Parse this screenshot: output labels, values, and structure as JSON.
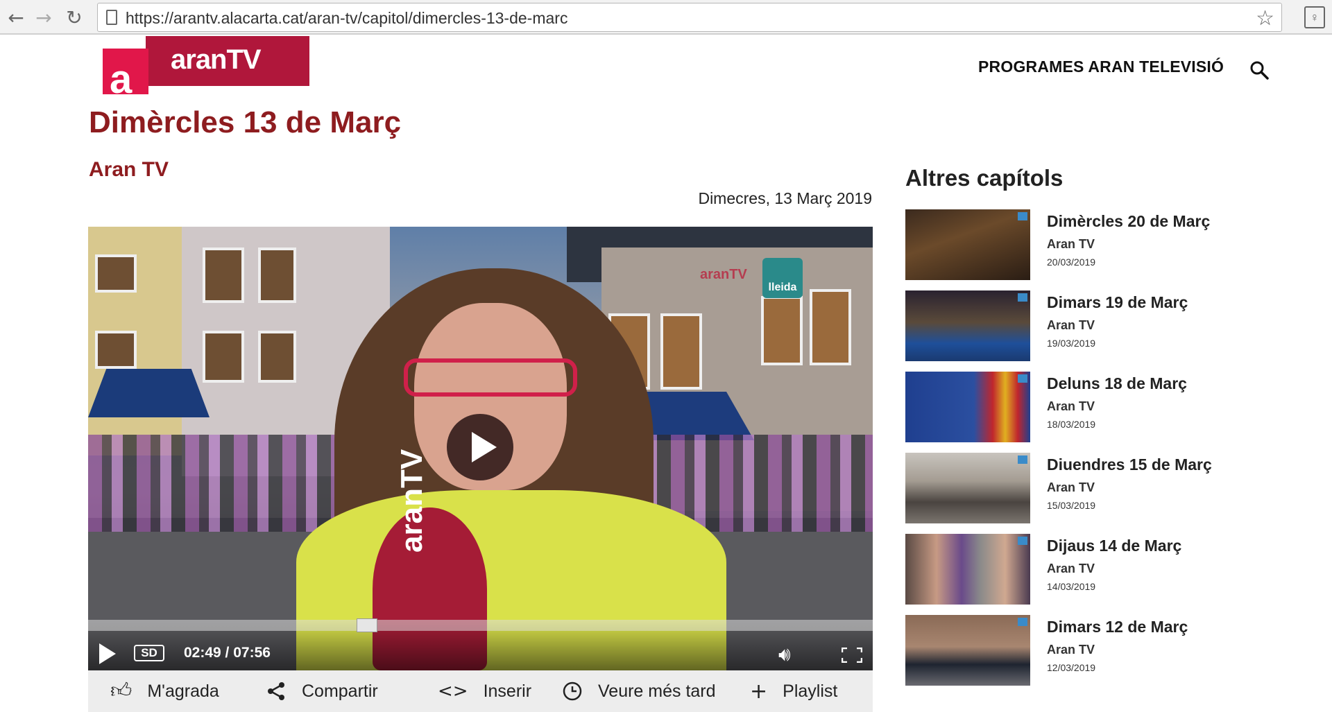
{
  "browser": {
    "url": "https://arantv.alacarta.cat/aran-tv/capitol/dimercles-13-de-marc"
  },
  "header": {
    "logo_letter": "a",
    "logo_text": "aranTV",
    "nav_label": "PROGRAMES ARAN TELEVISIÓ"
  },
  "page": {
    "title": "Dimèrcles 13 de Març",
    "channel": "Aran TV",
    "date": "Dimecres, 13 Març 2019"
  },
  "player": {
    "watermark_tv": "aranTV",
    "watermark_lleida": "lleida",
    "mic_text": "aranTV",
    "quality": "SD",
    "time": "02:49 / 07:56",
    "progress": 0.355
  },
  "actions": {
    "like": "M'agrada",
    "share": "Compartir",
    "embed": "Inserir",
    "later": "Veure més tard",
    "playlist": "Playlist"
  },
  "sidebar": {
    "title": "Altres capítols",
    "episodes": [
      {
        "title": "Dimèrcles 20 de Març",
        "channel": "Aran TV",
        "date": "20/03/2019"
      },
      {
        "title": "Dimars 19 de Març",
        "channel": "Aran TV",
        "date": "19/03/2019"
      },
      {
        "title": "Deluns 18 de Març",
        "channel": "Aran TV",
        "date": "18/03/2019"
      },
      {
        "title": "Diuendres 15 de Març",
        "channel": "Aran TV",
        "date": "15/03/2019"
      },
      {
        "title": "Dijaus 14 de Març",
        "channel": "Aran TV",
        "date": "14/03/2019"
      },
      {
        "title": "Dimars 12 de Març",
        "channel": "Aran TV",
        "date": "12/03/2019"
      }
    ]
  },
  "colors": {
    "brand_dark": "#b0173b",
    "brand_light": "#e1174a",
    "title_red": "#8e1c1f"
  }
}
